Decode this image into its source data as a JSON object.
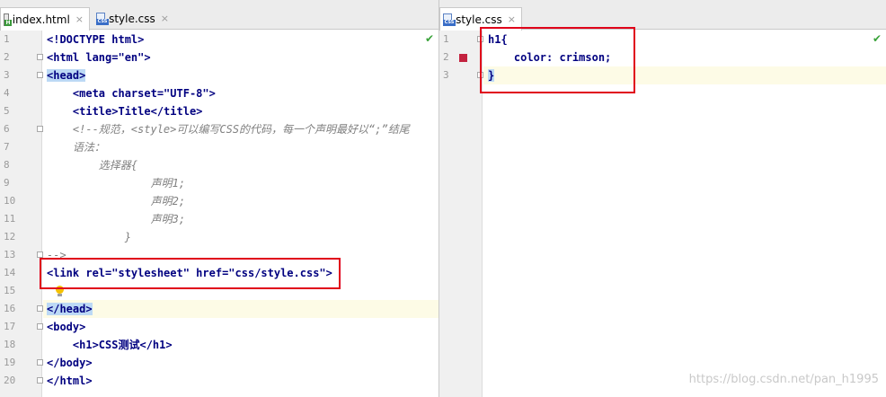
{
  "editor": {
    "left_tabs": [
      {
        "label": "index.html",
        "icon": "html-file-icon",
        "active": true
      },
      {
        "label": "style.css",
        "icon": "css-file-icon",
        "active": false
      }
    ],
    "right_tabs": [
      {
        "label": "style.css",
        "icon": "css-file-icon",
        "active": true
      }
    ],
    "close_glyph": "×",
    "check_glyph": "✔"
  },
  "left_code": {
    "line_numbers": [
      "1",
      "2",
      "3",
      "4",
      "5",
      "6",
      "7",
      "8",
      "9",
      "10",
      "11",
      "12",
      "13",
      "14",
      "15",
      "16",
      "17",
      "18",
      "19",
      "20"
    ],
    "lines": [
      "<!DOCTYPE html>",
      "<html lang=\"en\">",
      "<head>",
      "    <meta charset=\"UTF-8\">",
      "    <title>Title</title>",
      "    <!--规范，<style>可以编写CSS的代码，每一个声明最好以“;”结尾",
      "    语法：",
      "        选择器{",
      "                声明1;",
      "                声明2;",
      "                声明3;",
      "            }",
      "-->",
      "<link rel=\"stylesheet\" href=\"css/style.css\">",
      "",
      "</head>",
      "<body>",
      "    <h1>CSS测试</h1>",
      "</body>",
      "</html>"
    ]
  },
  "right_code": {
    "line_numbers": [
      "1",
      "2",
      "3"
    ],
    "lines": [
      "h1{",
      "    color: crimson;",
      "}"
    ]
  },
  "watermark": "https://blog.csdn.net/pan_h1995",
  "colors": {
    "tag": "#000080",
    "attr": "#0000ff",
    "string": "#008000",
    "comment": "#808080",
    "annotation_box": "#e0001a",
    "breakpoint": "#c3223f",
    "current_line": "#fdfbe6"
  }
}
